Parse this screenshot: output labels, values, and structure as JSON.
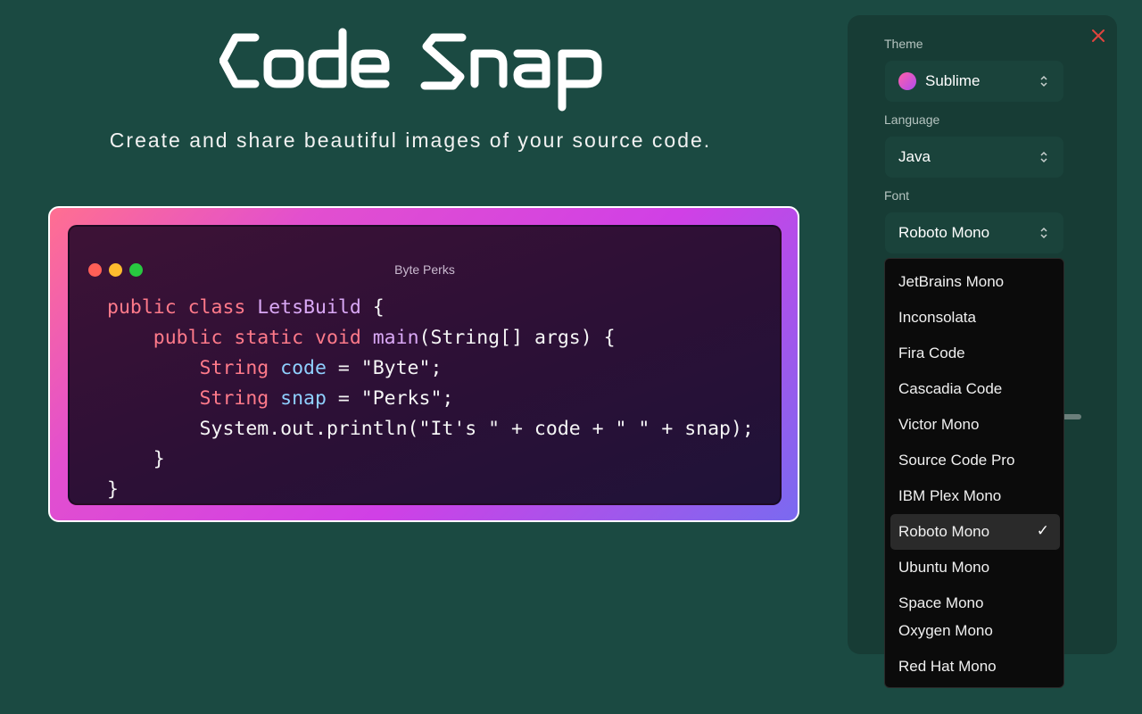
{
  "app": {
    "title": "Code Snap",
    "tagline": "Create and share beautiful images of your source code."
  },
  "preview": {
    "window_title": "Byte Perks",
    "code_lines": [
      [
        {
          "t": "public ",
          "c": "kw"
        },
        {
          "t": "class ",
          "c": "kw"
        },
        {
          "t": "LetsBuild",
          "c": "cls"
        },
        {
          "t": " {",
          "c": ""
        }
      ],
      [
        {
          "t": "    public ",
          "c": "kw"
        },
        {
          "t": "static ",
          "c": "kw"
        },
        {
          "t": "void ",
          "c": "kw"
        },
        {
          "t": "main",
          "c": "cls"
        },
        {
          "t": "(String[] args) {",
          "c": ""
        }
      ],
      [
        {
          "t": "        String ",
          "c": "kw"
        },
        {
          "t": "code",
          "c": "var"
        },
        {
          "t": " = \"Byte\";",
          "c": ""
        }
      ],
      [
        {
          "t": "        String ",
          "c": "kw"
        },
        {
          "t": "snap",
          "c": "var"
        },
        {
          "t": " = \"Perks\";",
          "c": ""
        }
      ],
      [
        {
          "t": "        System.out.println(\"It's \" + code + \" \" + snap);",
          "c": ""
        }
      ],
      [
        {
          "t": "    }",
          "c": ""
        }
      ],
      [
        {
          "t": "}",
          "c": ""
        }
      ]
    ],
    "traffic_lights": [
      "#ff5f57",
      "#febc2e",
      "#28c840"
    ],
    "frame_gradient": [
      "#ff6f91",
      "#d040e6",
      "#7a6af0"
    ]
  },
  "settings": {
    "theme_label": "Theme",
    "theme_value": "Sublime",
    "language_label": "Language",
    "language_value": "Java",
    "font_label": "Font",
    "font_value": "Roboto Mono"
  },
  "font_dropdown": {
    "selected": "Roboto Mono",
    "options": [
      "JetBrains Mono",
      "Inconsolata",
      "Fira Code",
      "Cascadia Code",
      "Victor Mono",
      "Source Code Pro",
      "IBM Plex Mono",
      "Roboto Mono",
      "Ubuntu Mono",
      "Space Mono",
      "Oxygen Mono",
      "Red Hat Mono"
    ],
    "check_mark": "✓"
  },
  "colors": {
    "background": "#1b4a42",
    "panel": "#173c35",
    "close_icon": "#e0443e"
  }
}
